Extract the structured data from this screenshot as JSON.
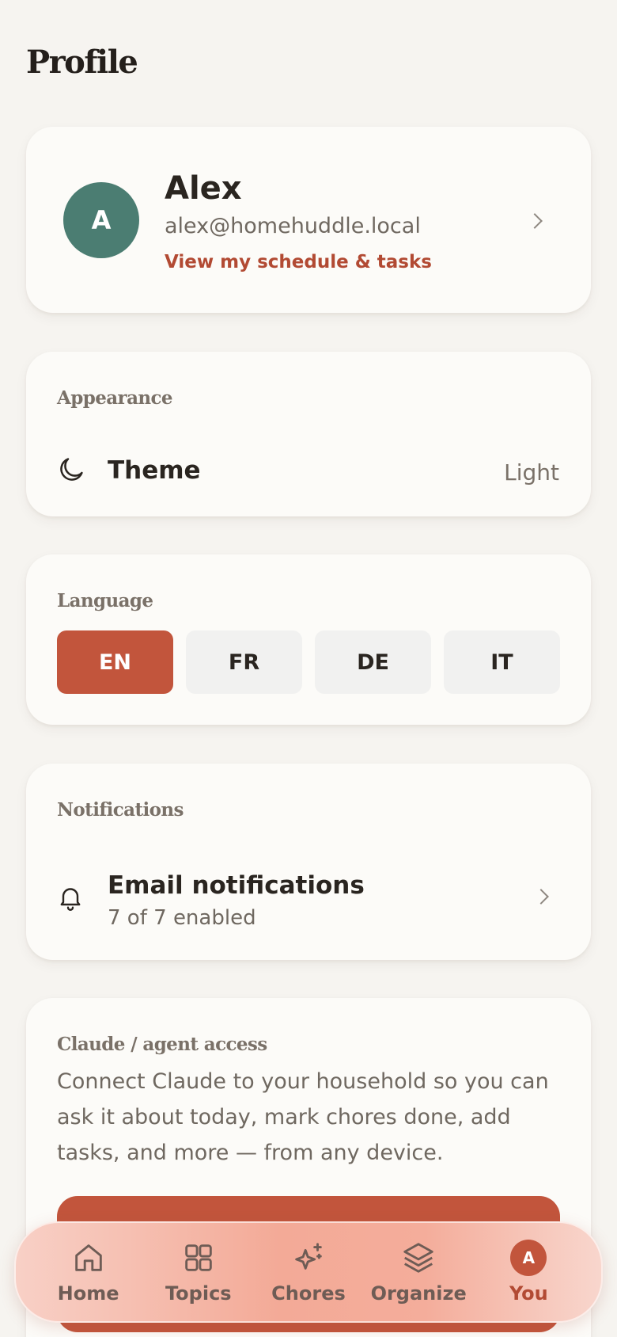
{
  "page": {
    "title": "Profile"
  },
  "profile": {
    "avatar_initial": "A",
    "name": "Alex",
    "email": "alex@homehuddle.local",
    "link": "View my schedule & tasks"
  },
  "appearance": {
    "section": "Appearance",
    "theme_label": "Theme",
    "theme_value": "Light",
    "icon": "moon-icon"
  },
  "language": {
    "section": "Language",
    "options": [
      {
        "label": "EN",
        "active": true
      },
      {
        "label": "FR",
        "active": false
      },
      {
        "label": "DE",
        "active": false
      },
      {
        "label": "IT",
        "active": false
      }
    ]
  },
  "notifications": {
    "section": "Notifications",
    "title": "Email notifications",
    "subtitle": "7 of 7 enabled",
    "icon": "bell-icon"
  },
  "claude": {
    "section": "Claude / agent access",
    "description": "Connect Claude to your household so you can ask it about today, mark chores done, add tasks, and more — from any device."
  },
  "nav": {
    "items": [
      {
        "label": "Home",
        "icon": "home-icon"
      },
      {
        "label": "Topics",
        "icon": "grid-icon"
      },
      {
        "label": "Chores",
        "icon": "sparkle-icon"
      },
      {
        "label": "Organize",
        "icon": "layers-icon"
      },
      {
        "label": "You",
        "icon": "avatar",
        "avatar_initial": "A",
        "active": true
      }
    ]
  },
  "colors": {
    "accent": "#c2553c",
    "avatar": "#4b7d72",
    "background": "#f6f4f0",
    "card": "#fcfbf8"
  }
}
